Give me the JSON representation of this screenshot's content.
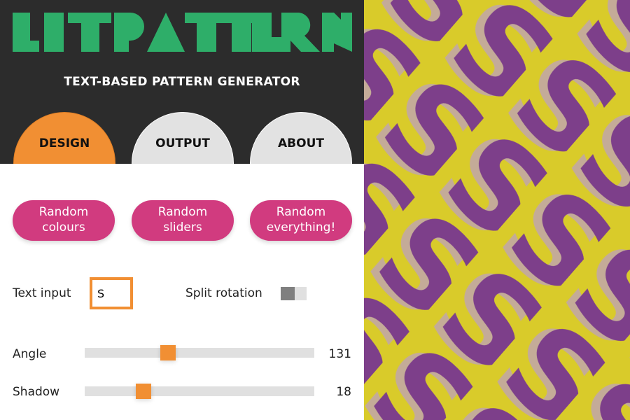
{
  "app": {
    "logo": "LITPATTERN",
    "subtitle": "TEXT-BASED PATTERN GENERATOR"
  },
  "tabs": [
    {
      "label": "DESIGN",
      "active": true
    },
    {
      "label": "OUTPUT",
      "active": false
    },
    {
      "label": "ABOUT",
      "active": false
    }
  ],
  "random_buttons": [
    {
      "line1": "Random",
      "line2": "colours"
    },
    {
      "line1": "Random",
      "line2": "sliders"
    },
    {
      "line1": "Random",
      "line2": "everything!"
    }
  ],
  "text_input": {
    "label": "Text input",
    "value": "S"
  },
  "split_rotation": {
    "label": "Split rotation",
    "on": false
  },
  "sliders": [
    {
      "label": "Angle",
      "value": 131,
      "min": 0,
      "max": 360
    },
    {
      "label": "Shadow",
      "value": 18,
      "min": 0,
      "max": 70
    }
  ],
  "colors": {
    "accent": "#f18f33",
    "brand_green": "#2eae69",
    "button_pink": "#d13b7f",
    "header_bg": "#2c2c2c",
    "pattern_bg": "#d9cb2a",
    "pattern_fg": "#7d3f8a",
    "pattern_shadow": "#c4ab98"
  }
}
